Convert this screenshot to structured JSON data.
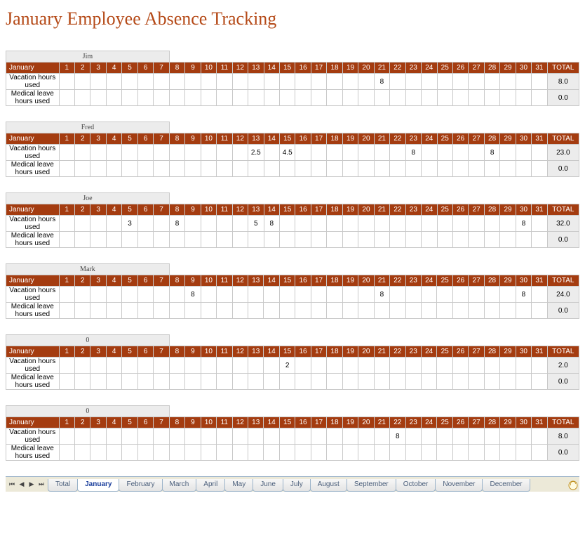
{
  "title": "January Employee Absence Tracking",
  "row_labels": {
    "vacation": "Vacation hours used",
    "medical": "Medical leave hours used"
  },
  "header": {
    "month": "January",
    "total": "TOTAL"
  },
  "days": [
    "1",
    "2",
    "3",
    "4",
    "5",
    "6",
    "7",
    "8",
    "9",
    "10",
    "11",
    "12",
    "13",
    "14",
    "15",
    "16",
    "17",
    "18",
    "19",
    "20",
    "21",
    "22",
    "23",
    "24",
    "25",
    "26",
    "27",
    "28",
    "29",
    "30",
    "31"
  ],
  "employees": [
    {
      "name": "Jim",
      "vacation": {
        "21": "8"
      },
      "vac_total": "8.0",
      "med_total": "0.0"
    },
    {
      "name": "Fred",
      "vacation": {
        "13": "2.5",
        "15": "4.5",
        "23": "8",
        "28": "8"
      },
      "vac_total": "23.0",
      "med_total": "0.0"
    },
    {
      "name": "Joe",
      "vacation": {
        "5": "3",
        "8": "8",
        "13": "5",
        "14": "8",
        "30": "8"
      },
      "vac_total": "32.0",
      "med_total": "0.0"
    },
    {
      "name": "Mark",
      "vacation": {
        "9": "8",
        "21": "8",
        "30": "8"
      },
      "vac_total": "24.0",
      "med_total": "0.0"
    },
    {
      "name": "0",
      "vacation": {
        "15": "2"
      },
      "vac_total": "2.0",
      "med_total": "0.0"
    },
    {
      "name": "0",
      "vacation": {
        "22": "8"
      },
      "vac_total": "8.0",
      "med_total": "0.0"
    }
  ],
  "tabs": [
    "Total",
    "January",
    "February",
    "March",
    "April",
    "May",
    "June",
    "July",
    "August",
    "September",
    "October",
    "November",
    "December"
  ],
  "active_tab": "January"
}
